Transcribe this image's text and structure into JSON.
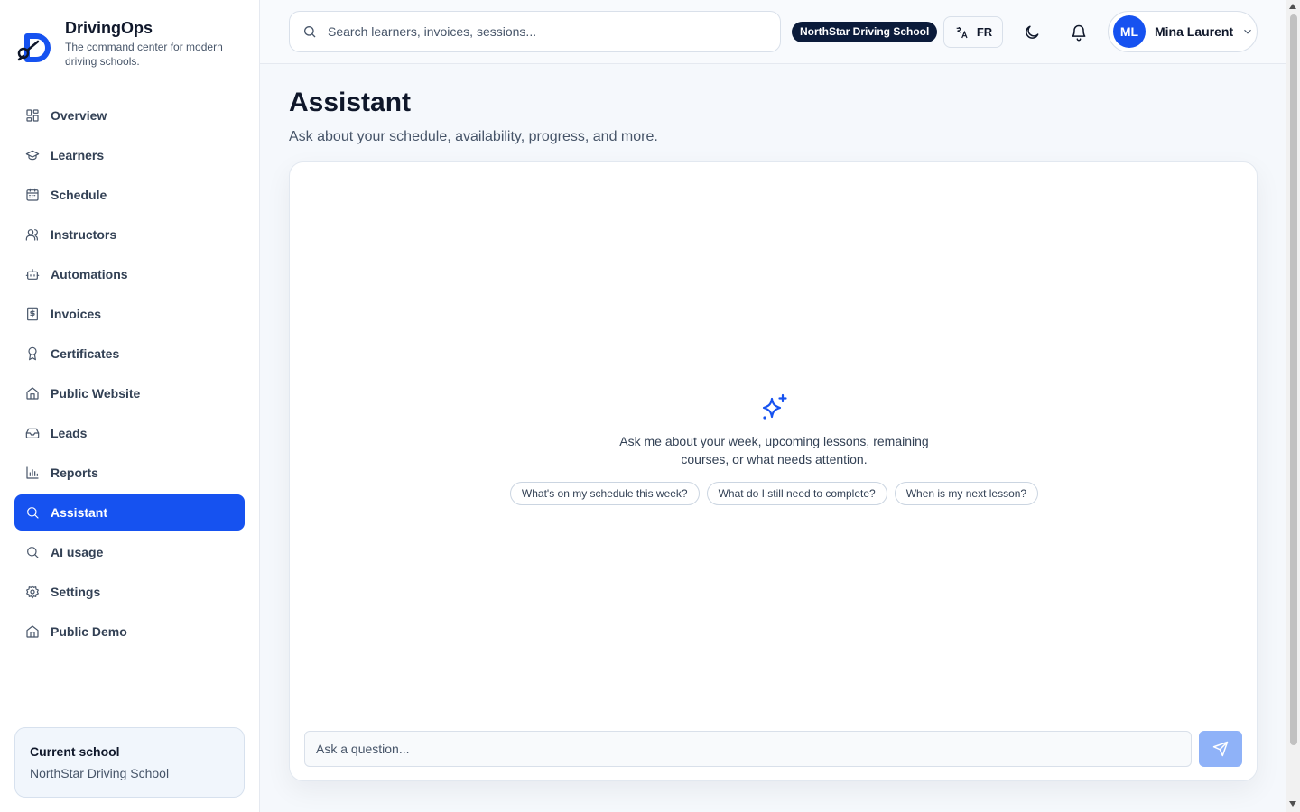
{
  "brand": {
    "name": "DrivingOps",
    "tagline": "The command center for modern driving schools."
  },
  "sidebar": {
    "items": [
      {
        "label": "Overview",
        "icon": "grid-icon"
      },
      {
        "label": "Learners",
        "icon": "graduation-cap-icon"
      },
      {
        "label": "Schedule",
        "icon": "calendar-icon"
      },
      {
        "label": "Instructors",
        "icon": "users-icon"
      },
      {
        "label": "Automations",
        "icon": "bot-icon"
      },
      {
        "label": "Invoices",
        "icon": "receipt-icon"
      },
      {
        "label": "Certificates",
        "icon": "award-icon"
      },
      {
        "label": "Public Website",
        "icon": "home-icon"
      },
      {
        "label": "Leads",
        "icon": "inbox-icon"
      },
      {
        "label": "Reports",
        "icon": "bar-chart-icon"
      },
      {
        "label": "Assistant",
        "icon": "search-icon",
        "active": true
      },
      {
        "label": "AI usage",
        "icon": "search-icon"
      },
      {
        "label": "Settings",
        "icon": "gear-icon"
      },
      {
        "label": "Public Demo",
        "icon": "home-icon"
      }
    ],
    "current_school": {
      "title": "Current school",
      "name": "NorthStar Driving School"
    }
  },
  "topbar": {
    "search_placeholder": "Search learners, invoices, sessions...",
    "school_badge": "NorthStar Driving School",
    "language": "FR",
    "user": {
      "initials": "ML",
      "name": "Mina Laurent"
    }
  },
  "main": {
    "title": "Assistant",
    "subtitle": "Ask about your schedule, availability, progress, and more.",
    "empty_state": "Ask me about your week, upcoming lessons, remaining courses, or what needs attention.",
    "suggestions": [
      "What's on my schedule this week?",
      "What do I still need to complete?",
      "When is my next lesson?"
    ],
    "input_placeholder": "Ask a question..."
  },
  "colors": {
    "accent": "#1652f0",
    "badge_bg": "#0b1b3a",
    "send_button": "#8fb2f8"
  }
}
